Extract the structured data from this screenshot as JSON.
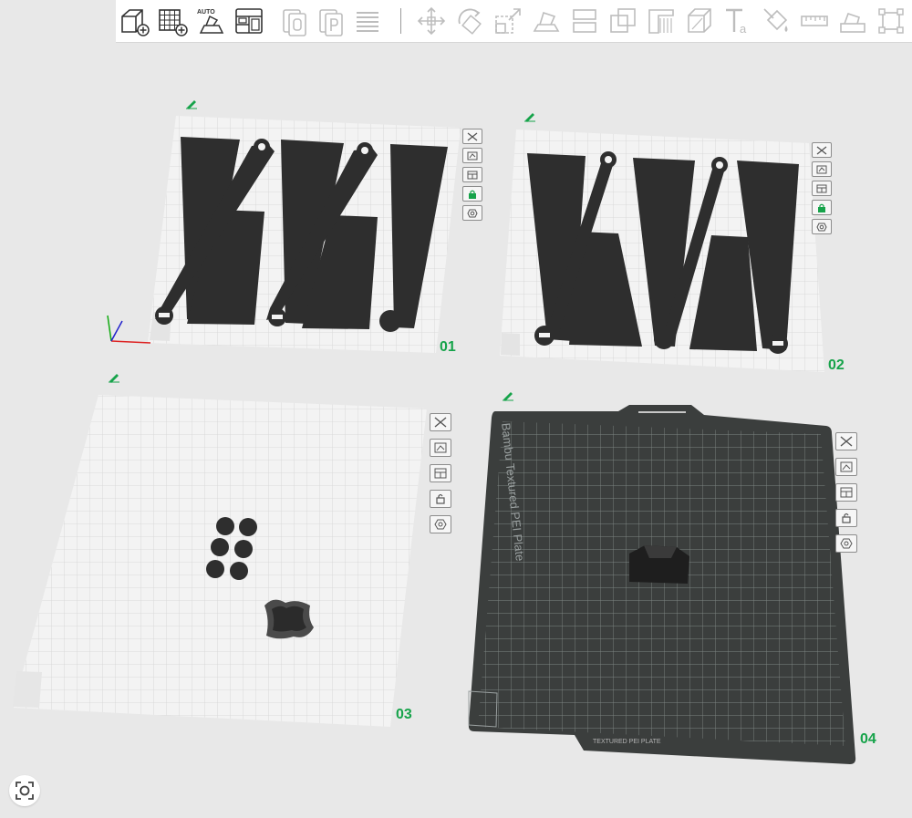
{
  "toolbar": {
    "buttons": [
      {
        "icon": "add-cube-icon",
        "enabled": true
      },
      {
        "icon": "add-plate-icon",
        "enabled": true
      },
      {
        "icon": "auto-orient-icon",
        "enabled": true,
        "label": "AUTO"
      },
      {
        "icon": "arrange-icon",
        "enabled": true
      },
      {
        "icon": "copy-icon",
        "enabled": false
      },
      {
        "icon": "paste-icon",
        "enabled": false
      },
      {
        "icon": "layers-icon",
        "enabled": false
      },
      {
        "icon": "move-icon",
        "enabled": false
      },
      {
        "icon": "rotate-icon",
        "enabled": false
      },
      {
        "icon": "scale-icon",
        "enabled": false
      },
      {
        "icon": "lay-on-face-icon",
        "enabled": false
      },
      {
        "icon": "cut-icon",
        "enabled": false
      },
      {
        "icon": "boolean-icon",
        "enabled": false
      },
      {
        "icon": "support-paint-icon",
        "enabled": false
      },
      {
        "icon": "seam-icon",
        "enabled": false
      },
      {
        "icon": "text-icon",
        "enabled": false
      },
      {
        "icon": "color-paint-icon",
        "enabled": false
      },
      {
        "icon": "measure-icon",
        "enabled": false
      },
      {
        "icon": "assembly-icon",
        "enabled": false
      },
      {
        "icon": "fit-view-icon",
        "enabled": false
      }
    ]
  },
  "plates": [
    {
      "number": "01",
      "locked": true
    },
    {
      "number": "02",
      "locked": true
    },
    {
      "number": "03",
      "locked": false
    },
    {
      "number": "04",
      "locked": false,
      "bed_label": "Bambu Textured PEI Plate",
      "footer_label": "TEXTURED PEI PLATE"
    }
  ],
  "colors": {
    "accent": "#16a34a",
    "plate_light": "#f3f3f3",
    "plate_dark": "#3b3e3d",
    "model": "#2e2e2e",
    "background": "#e8e8e8"
  }
}
